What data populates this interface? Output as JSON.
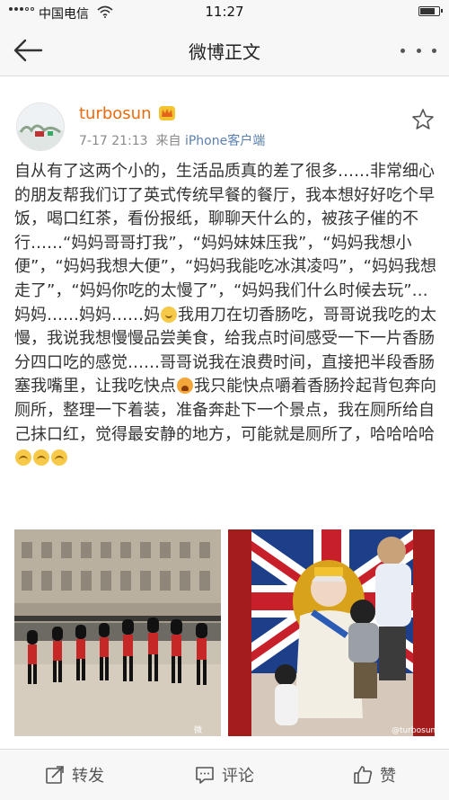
{
  "status_bar": {
    "carrier": "中国电信",
    "time": "11:27",
    "battery_level": 0.85
  },
  "nav": {
    "title": "微博正文"
  },
  "post": {
    "author": "turbosun",
    "meta_time": "7-17 21:13",
    "meta_from": "来自",
    "meta_source": "iPhone客户端",
    "text": {
      "p1": "自从有了这两个小的，生活品质真的差了很多……非常细心的朋友帮我们订了英式传统早餐的餐厅，我本想好好吃个早饭，喝口红茶，看份报纸，聊聊天什么的，被孩子催的不行……“妈妈哥哥打我”，“妈妈妹妹压我”，“妈妈我想小便”，“妈妈我想大便”，“妈妈我能吃冰淇凌吗”，“妈妈我想走了”，“妈妈你吃的太慢了”，“妈妈我们什么时候去玩”…妈妈……妈妈……妈",
      "p2": "我用刀在切香肠吃，哥哥说我吃的太慢，我说我想慢慢品尝美食，给我点时间感受一下一片香肠分四口吃的感觉……哥哥说我在浪费时间，直接把半段香肠塞我嘴里，让我吃快点",
      "p3": "我只能快点嚼着香肠拎起背包奔向厕所，整理一下着装，准备奔赴下一个景点，我在厕所给自己抹口红，觉得最安静的地方，可能就是厕所了，哈哈哈哈"
    },
    "watermark": "@turbosun"
  },
  "actions": {
    "repost": "转发",
    "comment": "评论",
    "like": "赞"
  },
  "icons": {
    "back": "back-arrow-icon",
    "more": "more-dots-icon",
    "star": "favorite-star-icon",
    "crown": "vip-crown-icon",
    "repost": "repost-icon",
    "comment": "comment-icon",
    "like": "thumbs-up-icon"
  },
  "colors": {
    "username": "#e86b0f",
    "source": "#5a7fb0",
    "text": "#333333"
  }
}
